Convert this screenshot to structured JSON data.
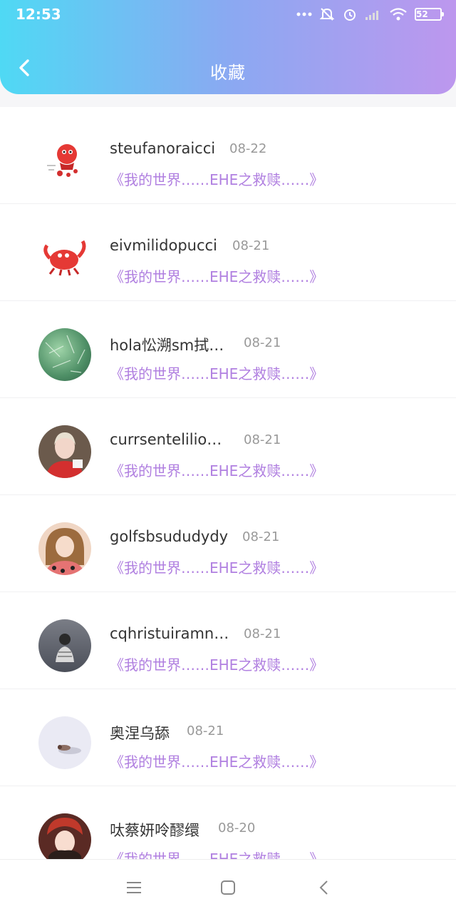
{
  "status_bar": {
    "time": "12:53",
    "battery": "52"
  },
  "header": {
    "title": "收藏"
  },
  "items": [
    {
      "name": "steufanoraicci",
      "date": "08-22",
      "desc": "《我的世界……EHE之救赎……》"
    },
    {
      "name": "eivmilidopucci",
      "date": "08-21",
      "desc": "《我的世界……EHE之救赎……》"
    },
    {
      "name": "hola忪溯sm拭…",
      "date": "08-21",
      "desc": "《我的世界……EHE之救赎……》"
    },
    {
      "name": "currsentelilio…",
      "date": "08-21",
      "desc": "《我的世界……EHE之救赎……》"
    },
    {
      "name": "golfsbsududydy",
      "date": "08-21",
      "desc": "《我的世界……EHE之救赎……》"
    },
    {
      "name": "cqhristuiramn…",
      "date": "08-21",
      "desc": "《我的世界……EHE之救赎……》"
    },
    {
      "name": "奥涅乌舔",
      "date": "08-21",
      "desc": "《我的世界……EHE之救赎……》"
    },
    {
      "name": "呔蔡妍呤醪缳",
      "date": "08-20",
      "desc": "《我的世界……EHE之救赎……》"
    }
  ],
  "icons": {
    "back": "chevron-left-icon",
    "menu": "menu-icon",
    "home": "home-square-icon",
    "nav_back": "nav-back-icon"
  },
  "colors": {
    "header_start": "#4fd9f4",
    "header_end": "#bd97ee",
    "accent_text": "#b07fe0"
  }
}
